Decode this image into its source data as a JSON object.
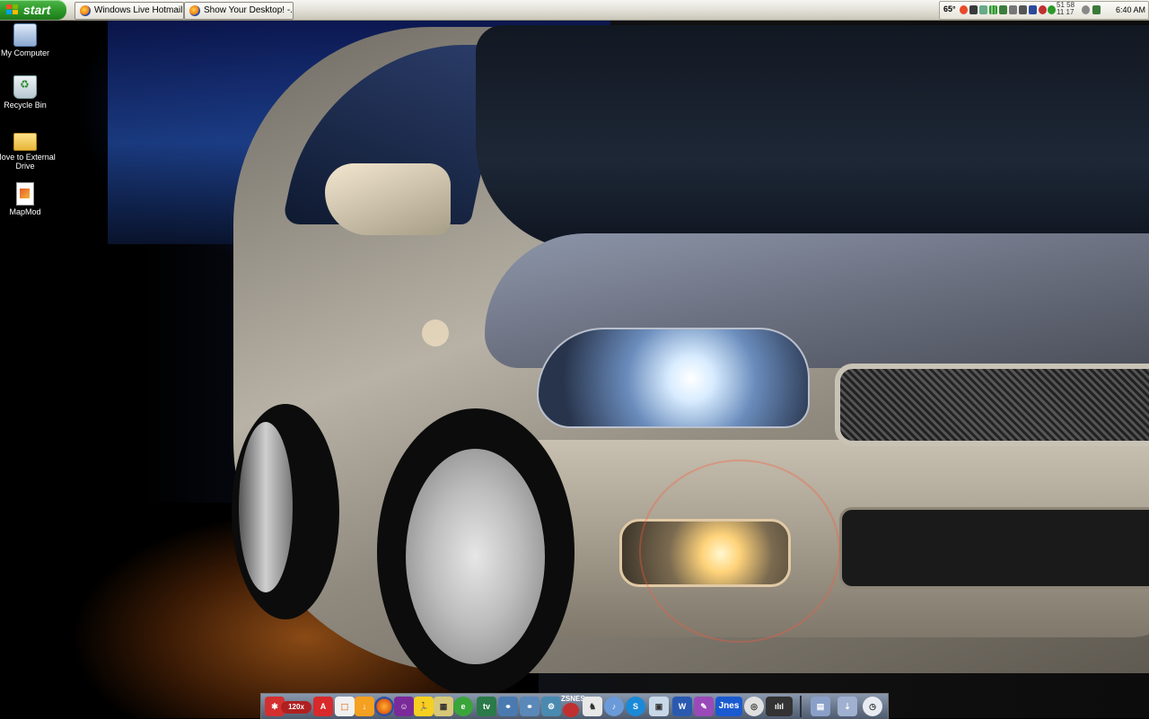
{
  "taskbar": {
    "start_label": "start",
    "windows": [
      {
        "title": "Windows Live Hotmail..."
      },
      {
        "title": "Show Your Desktop! -..."
      }
    ],
    "tray": {
      "temperature": "65°",
      "meter_top": "51 58",
      "meter_bottom": "11 17",
      "clock": "6:40 AM"
    }
  },
  "desktop_icons": [
    {
      "label": "My Computer",
      "icon": "my-computer-icon"
    },
    {
      "label": "Recycle Bin",
      "icon": "recycle-bin-icon"
    },
    {
      "label": "Move to External Drive",
      "icon": "folder-icon"
    },
    {
      "label": "MapMod",
      "icon": "mapmod-icon"
    }
  ],
  "dock": {
    "zoom_badge": "120x",
    "zsnes_label": "ZSNES",
    "jnes_label": "Jnes",
    "items": [
      "tool-icon",
      "acrobat-icon",
      "office-icon",
      "flashget-icon",
      "firefox-icon",
      "yahoo-messenger-icon",
      "aim-icon",
      "archive-icon",
      "internet-explorer-icon",
      "tv-icon",
      "network-icon",
      "connection-icon",
      "settings-icon",
      "zsnes-icon",
      "chess-icon",
      "itunes-icon",
      "skype-icon",
      "photo-icon",
      "word-icon",
      "paint-icon",
      "jnes-icon",
      "sound-icon",
      "audio-icon",
      "dock-manager-icon",
      "download-icon",
      "clock-icon"
    ]
  },
  "colors": {
    "taskbar_bg": "#dedcd2",
    "start_green": "#2e9a2a",
    "dock_bg": "#4e5a6e"
  }
}
